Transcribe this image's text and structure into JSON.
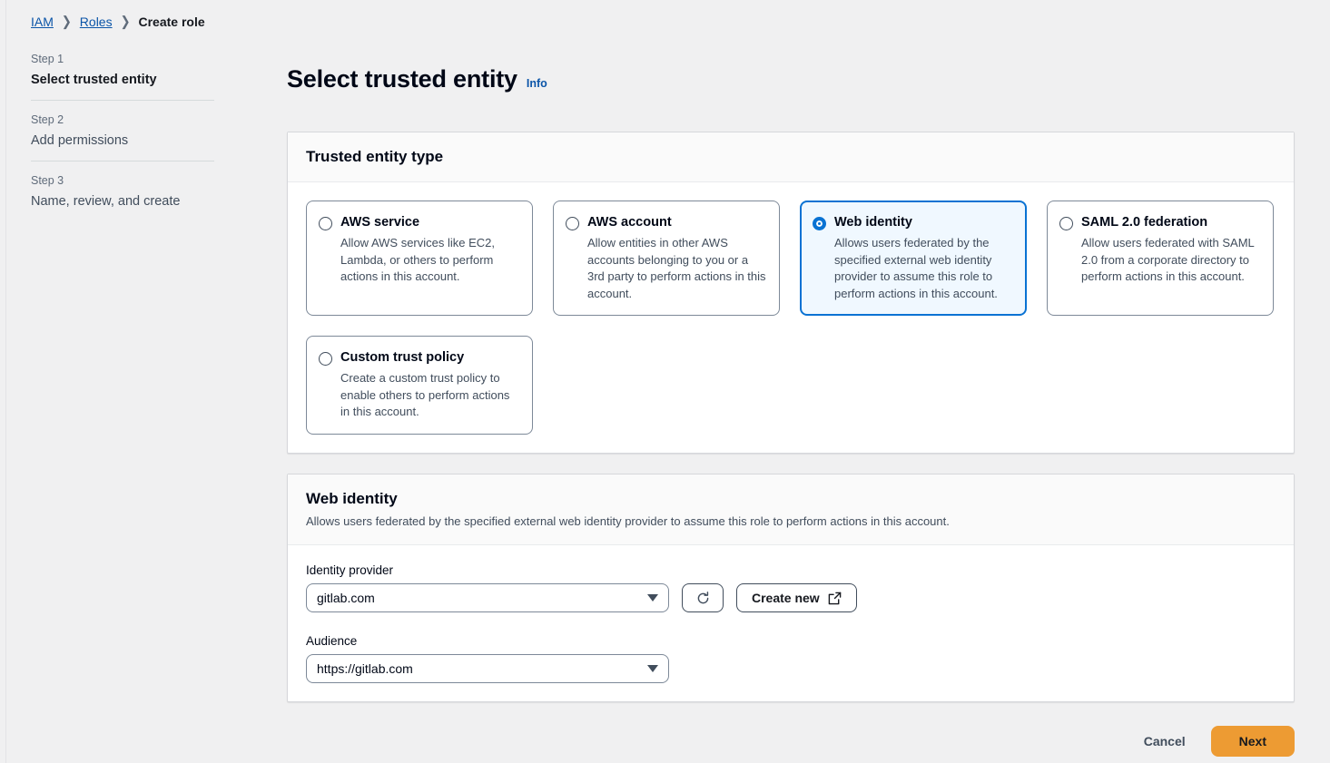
{
  "breadcrumb": {
    "items": [
      {
        "label": "IAM",
        "is_link": true
      },
      {
        "label": "Roles",
        "is_link": true
      },
      {
        "label": "Create role",
        "is_link": false
      }
    ],
    "separator": "❯"
  },
  "sidebar": {
    "steps": [
      {
        "number": "Step 1",
        "label": "Select trusted entity",
        "active": true
      },
      {
        "number": "Step 2",
        "label": "Add permissions",
        "active": false
      },
      {
        "number": "Step 3",
        "label": "Name, review, and create",
        "active": false
      }
    ]
  },
  "page": {
    "title": "Select trusted entity",
    "info_label": "Info"
  },
  "trusted_entity_panel": {
    "title": "Trusted entity type",
    "options": [
      {
        "title": "AWS service",
        "description": "Allow AWS services like EC2, Lambda, or others to perform actions in this account.",
        "selected": false
      },
      {
        "title": "AWS account",
        "description": "Allow entities in other AWS accounts belonging to you or a 3rd party to perform actions in this account.",
        "selected": false
      },
      {
        "title": "Web identity",
        "description": "Allows users federated by the specified external web identity provider to assume this role to perform actions in this account.",
        "selected": true
      },
      {
        "title": "SAML 2.0 federation",
        "description": "Allow users federated with SAML 2.0 from a corporate directory to perform actions in this account.",
        "selected": false
      },
      {
        "title": "Custom trust policy",
        "description": "Create a custom trust policy to enable others to perform actions in this account.",
        "selected": false
      }
    ]
  },
  "web_identity_panel": {
    "title": "Web identity",
    "description": "Allows users federated by the specified external web identity provider to assume this role to perform actions in this account.",
    "identity_provider": {
      "label": "Identity provider",
      "value": "gitlab.com"
    },
    "refresh_button": {
      "icon": "refresh-icon"
    },
    "create_new_button": {
      "label": "Create new",
      "icon": "external-link-icon"
    },
    "audience": {
      "label": "Audience",
      "value": "https://gitlab.com"
    }
  },
  "footer": {
    "cancel_label": "Cancel",
    "next_label": "Next"
  },
  "colors": {
    "accent_blue": "#0972d3",
    "link_blue": "#0b55a8",
    "primary_orange": "#ed9b33",
    "page_background": "#f0f0f1",
    "selected_tile_background": "#f0f8ff"
  }
}
